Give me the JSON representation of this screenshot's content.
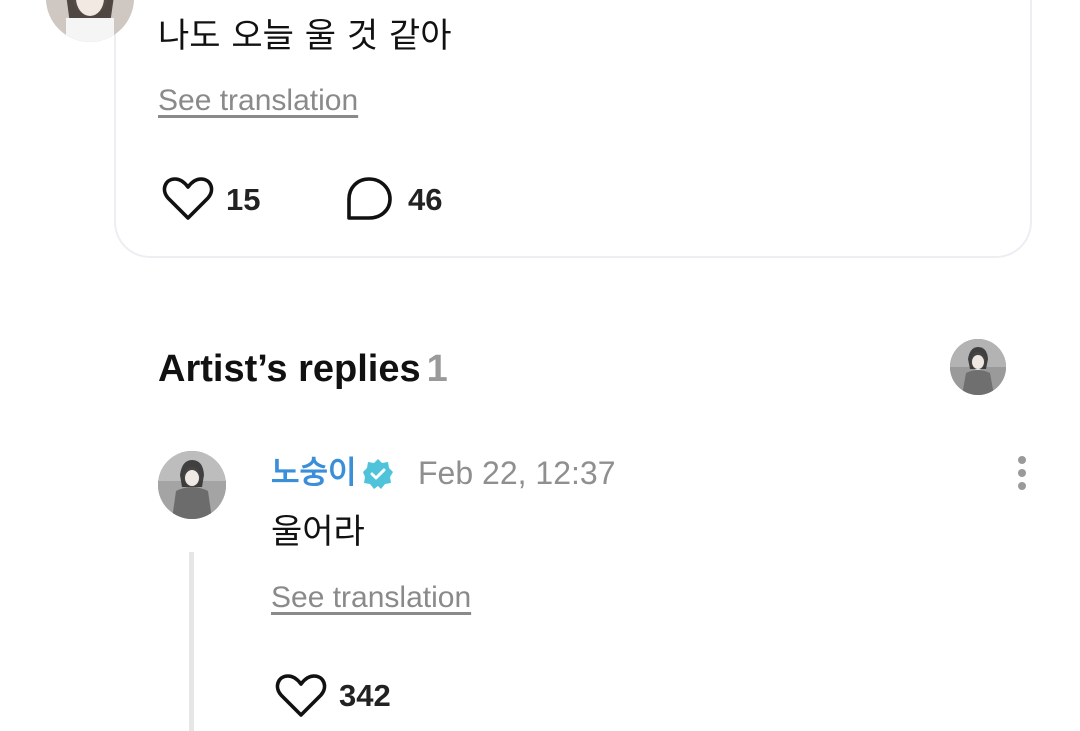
{
  "post": {
    "text": "나도 오늘 울 것 같아",
    "see_translation": "See translation",
    "likes": "15",
    "comments": "46"
  },
  "artist_replies": {
    "title": "Artist’s replies",
    "count": "1"
  },
  "reply": {
    "author": "노숭이",
    "date": "Feb 22, 12:37",
    "text": "울어라",
    "see_translation": "See translation",
    "likes": "342"
  },
  "colors": {
    "artist_name": "#3a8fd8",
    "verified_badge": "#4fc3d9",
    "muted_text": "#8f8f8f"
  },
  "icons": [
    "heart-icon",
    "comment-bubble-icon",
    "verified-badge-icon",
    "more-vertical-icon"
  ]
}
